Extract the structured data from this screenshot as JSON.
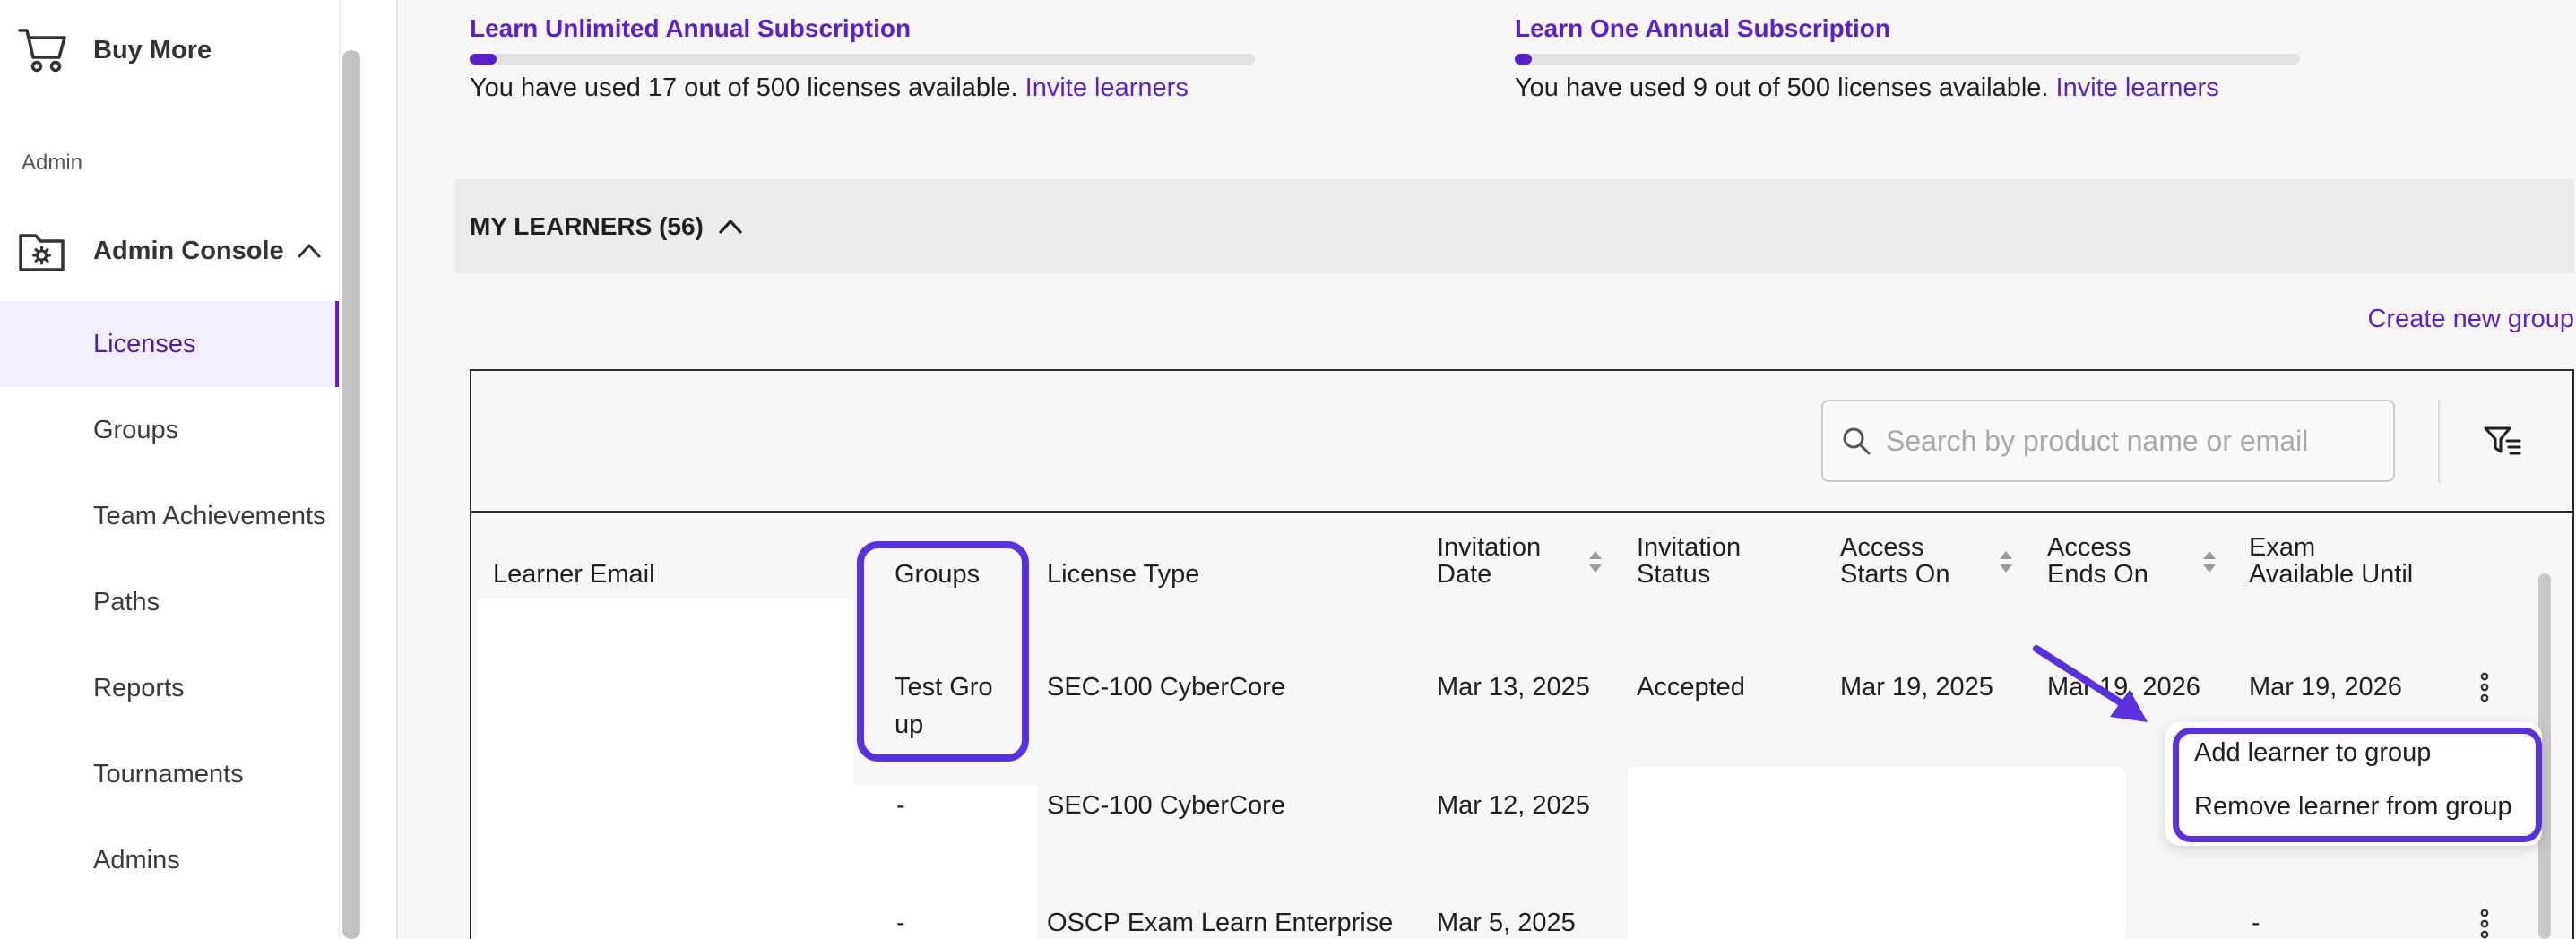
{
  "sidebar": {
    "buy_more": "Buy More",
    "section_heading": "Admin",
    "admin_console": "Admin Console",
    "items": [
      {
        "label": "Licenses"
      },
      {
        "label": "Groups"
      },
      {
        "label": "Team Achievements"
      },
      {
        "label": "Paths"
      },
      {
        "label": "Reports"
      },
      {
        "label": "Tournaments"
      },
      {
        "label": "Admins"
      }
    ],
    "active_item": "Licenses"
  },
  "subscriptions": [
    {
      "title": "Learn Unlimited Annual Subscription",
      "used": 17,
      "total": 500,
      "usage_prefix": "You have used 17 out of 500 licenses available.",
      "link": "Invite learners"
    },
    {
      "title": "Learn One Annual Subscription",
      "used": 9,
      "total": 500,
      "usage_prefix": "You have used 9 out of 500 licenses available.",
      "link": "Invite learners"
    }
  ],
  "learners_section": {
    "title": "MY LEARNERS (56)"
  },
  "create_group": "Create new group",
  "search": {
    "placeholder": "Search by product name or email",
    "value": ""
  },
  "table": {
    "headers": {
      "email": "Learner Email",
      "groups": "Groups",
      "license_type": "License Type",
      "invitation_date_1": "Invitation",
      "invitation_date_2": "Date",
      "invitation_status_1": "Invitation",
      "invitation_status_2": "Status",
      "access_starts_1": "Access",
      "access_starts_2": "Starts On",
      "access_ends_1": "Access",
      "access_ends_2": "Ends On",
      "exam_available_1": "Exam",
      "exam_available_2": "Available Until"
    },
    "rows": [
      {
        "group_line1": "Test Gro",
        "group_line2": "up",
        "license_type": "SEC-100 CyberCore",
        "invitation_date": "Mar 13, 2025",
        "invitation_status": "Accepted",
        "access_starts": "Mar 19, 2025",
        "access_ends_partial": "Ma",
        "access_ends_tail": "r 19, 2026",
        "exam_available": "Mar 19, 2026"
      },
      {
        "group": "-",
        "license_type": "SEC-100 CyberCore",
        "invitation_date": "Mar 12, 2025"
      },
      {
        "group": "-",
        "license_type": "OSCP Exam Learn Enterprise",
        "invitation_date": "Mar 5, 2025",
        "exam_available": "-"
      }
    ]
  },
  "context_menu": {
    "items": [
      "Add learner to group",
      "Remove learner from group"
    ]
  },
  "colors": {
    "accent": "#5a1fd1",
    "highlight": "#5a31e0",
    "active_bg": "#f2eef9"
  }
}
